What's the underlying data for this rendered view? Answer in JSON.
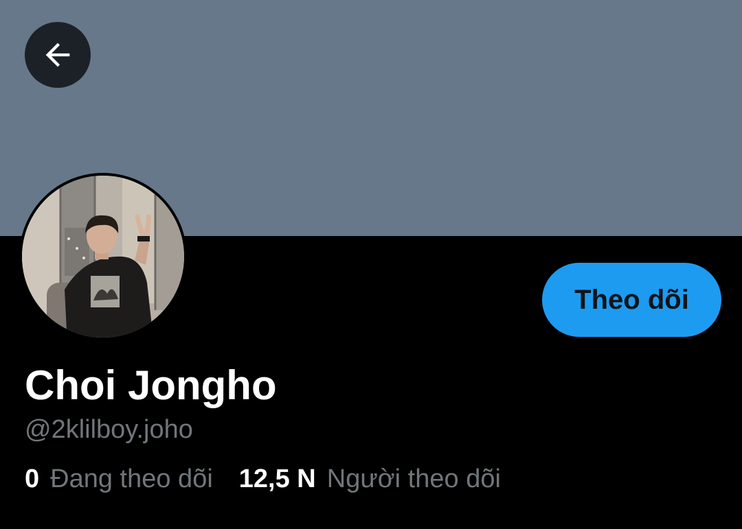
{
  "banner": {
    "color": "#66788a"
  },
  "header": {
    "back_icon": "arrow-left-icon"
  },
  "profile": {
    "follow_label": "Theo dõi",
    "display_name": "Choi Jongho",
    "handle": "@2klilboy.joho"
  },
  "stats": {
    "following_count": "0",
    "following_label": "Đang theo dõi",
    "followers_count": "12,5 N",
    "followers_label": "Người theo dõi"
  },
  "colors": {
    "accent": "#1d9bf0",
    "background": "#000000",
    "secondary_text": "#71767b"
  }
}
